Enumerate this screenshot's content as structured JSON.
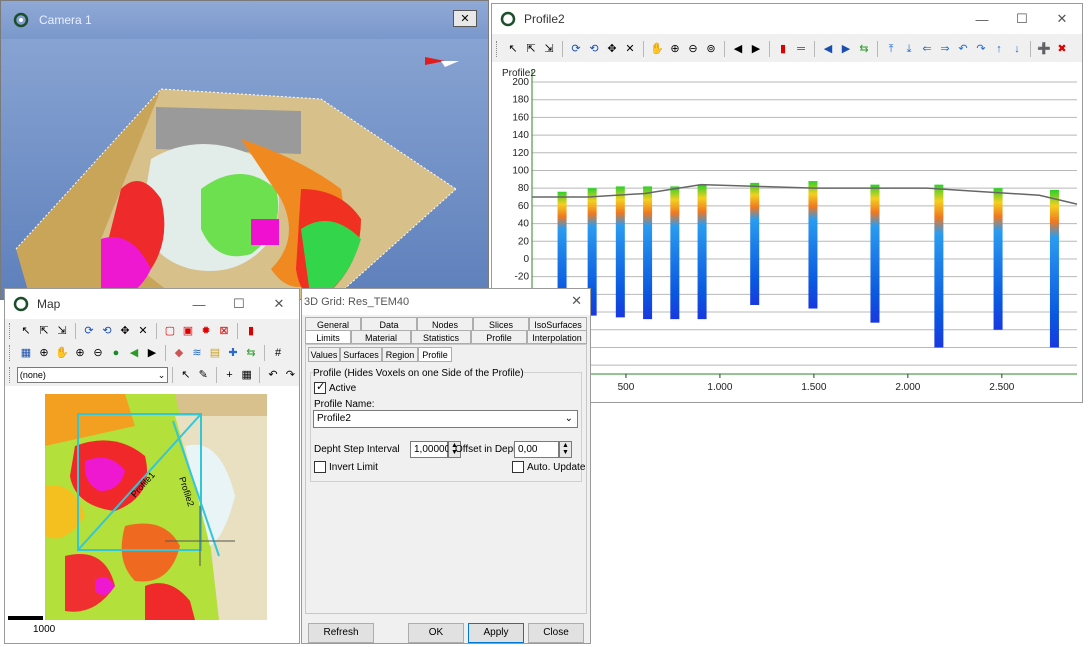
{
  "camera": {
    "title": "Camera 1",
    "close_icon": "close-icon"
  },
  "profile": {
    "title": "Profile2",
    "ylabel": "Profile2",
    "toolbar_icons": [
      "pointer-icon",
      "select-icon",
      "select-multi-icon",
      "rotate-icon",
      "rotate2-icon",
      "move-icon",
      "delete-icon",
      "pan-icon",
      "zoom-in-icon",
      "zoom-out-icon",
      "zoom-extent-icon",
      "prev-icon",
      "next-icon",
      "red-marker-icon",
      "red-dash-icon",
      "arrow-left-icon",
      "arrow-right-icon",
      "shuffle-icon",
      "top-icon",
      "bottom-icon",
      "left-icon",
      "right-icon",
      "undo-icon",
      "redo-icon",
      "up-icon",
      "down-icon",
      "add-icon",
      "remove-icon"
    ]
  },
  "chart_data": {
    "type": "bar",
    "title": "",
    "ylabel": "Profile2",
    "xlabel": "",
    "y_ticks": [
      "200",
      "180",
      "160",
      "140",
      "120",
      "100",
      "80",
      "60",
      "40",
      "20",
      "0",
      "-20",
      "-40",
      "-60",
      "-80"
    ],
    "x_ticks": [
      "500",
      "1.000",
      "1.500",
      "2.000",
      "2.500"
    ],
    "ylim": [
      -130,
      200
    ],
    "xlim": [
      0,
      2900
    ],
    "grid": true,
    "columns": [
      {
        "x": 160,
        "top": 76,
        "bottom": -64
      },
      {
        "x": 320,
        "top": 80,
        "bottom": -64
      },
      {
        "x": 470,
        "top": 82,
        "bottom": -66
      },
      {
        "x": 615,
        "top": 82,
        "bottom": -68
      },
      {
        "x": 760,
        "top": 82,
        "bottom": -68
      },
      {
        "x": 905,
        "top": 84,
        "bottom": -68
      },
      {
        "x": 1185,
        "top": 86,
        "bottom": -52
      },
      {
        "x": 1495,
        "top": 88,
        "bottom": -56
      },
      {
        "x": 1825,
        "top": 84,
        "bottom": -72
      },
      {
        "x": 2165,
        "top": 84,
        "bottom": -100
      },
      {
        "x": 2480,
        "top": 80,
        "bottom": -80
      },
      {
        "x": 2780,
        "top": 78,
        "bottom": -100
      }
    ],
    "surface_line": [
      [
        0,
        70
      ],
      [
        300,
        70
      ],
      [
        600,
        74
      ],
      [
        900,
        84
      ],
      [
        1200,
        82
      ],
      [
        1500,
        80
      ],
      [
        1800,
        80
      ],
      [
        2100,
        80
      ],
      [
        2400,
        76
      ],
      [
        2700,
        72
      ],
      [
        2900,
        62
      ]
    ]
  },
  "map": {
    "title": "Map",
    "combo_value": "(none)",
    "profile1_label": "Profile1",
    "profile2_label": "Profile2",
    "scale_label": "1000"
  },
  "grid": {
    "title": "3D Grid: Res_TEM40",
    "tabs_row1": [
      "General",
      "Data",
      "Nodes",
      "Slices",
      "IsoSurfaces"
    ],
    "tabs_row2": [
      "Limits",
      "Material",
      "Statistics",
      "Profile",
      "Interpolation"
    ],
    "subtabs": [
      "Values",
      "Surfaces",
      "Region",
      "Profile"
    ],
    "group_label": "Profile (Hides Voxels on one Side of the Profile)",
    "active_label": "Active",
    "profile_name_label": "Profile Name:",
    "profile_name_value": "Profile2",
    "depth_step_label": "Depht Step Interval",
    "depth_step_value": "1,000000",
    "offset_label": "Offset in Depht",
    "offset_value": "0,00",
    "invert_label": "Invert Limit",
    "auto_update_label": "Auto. Update",
    "refresh_label": "Refresh Data...",
    "ok_label": "OK",
    "apply_label": "Apply",
    "close_label": "Close"
  },
  "caption": {
    "minimize": "—",
    "maximize": "☐",
    "close": "✕"
  }
}
